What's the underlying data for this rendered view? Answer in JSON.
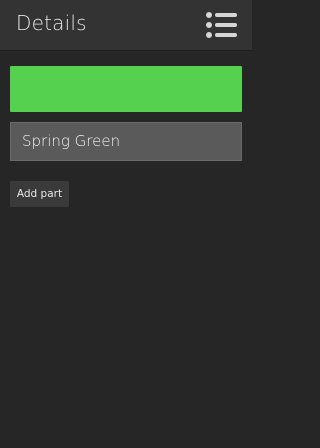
{
  "header": {
    "title": "Details",
    "menu_icon": "list-icon"
  },
  "color": {
    "swatch": "#55d14f",
    "name": "Spring Green"
  },
  "actions": {
    "add_part_label": "Add part"
  }
}
